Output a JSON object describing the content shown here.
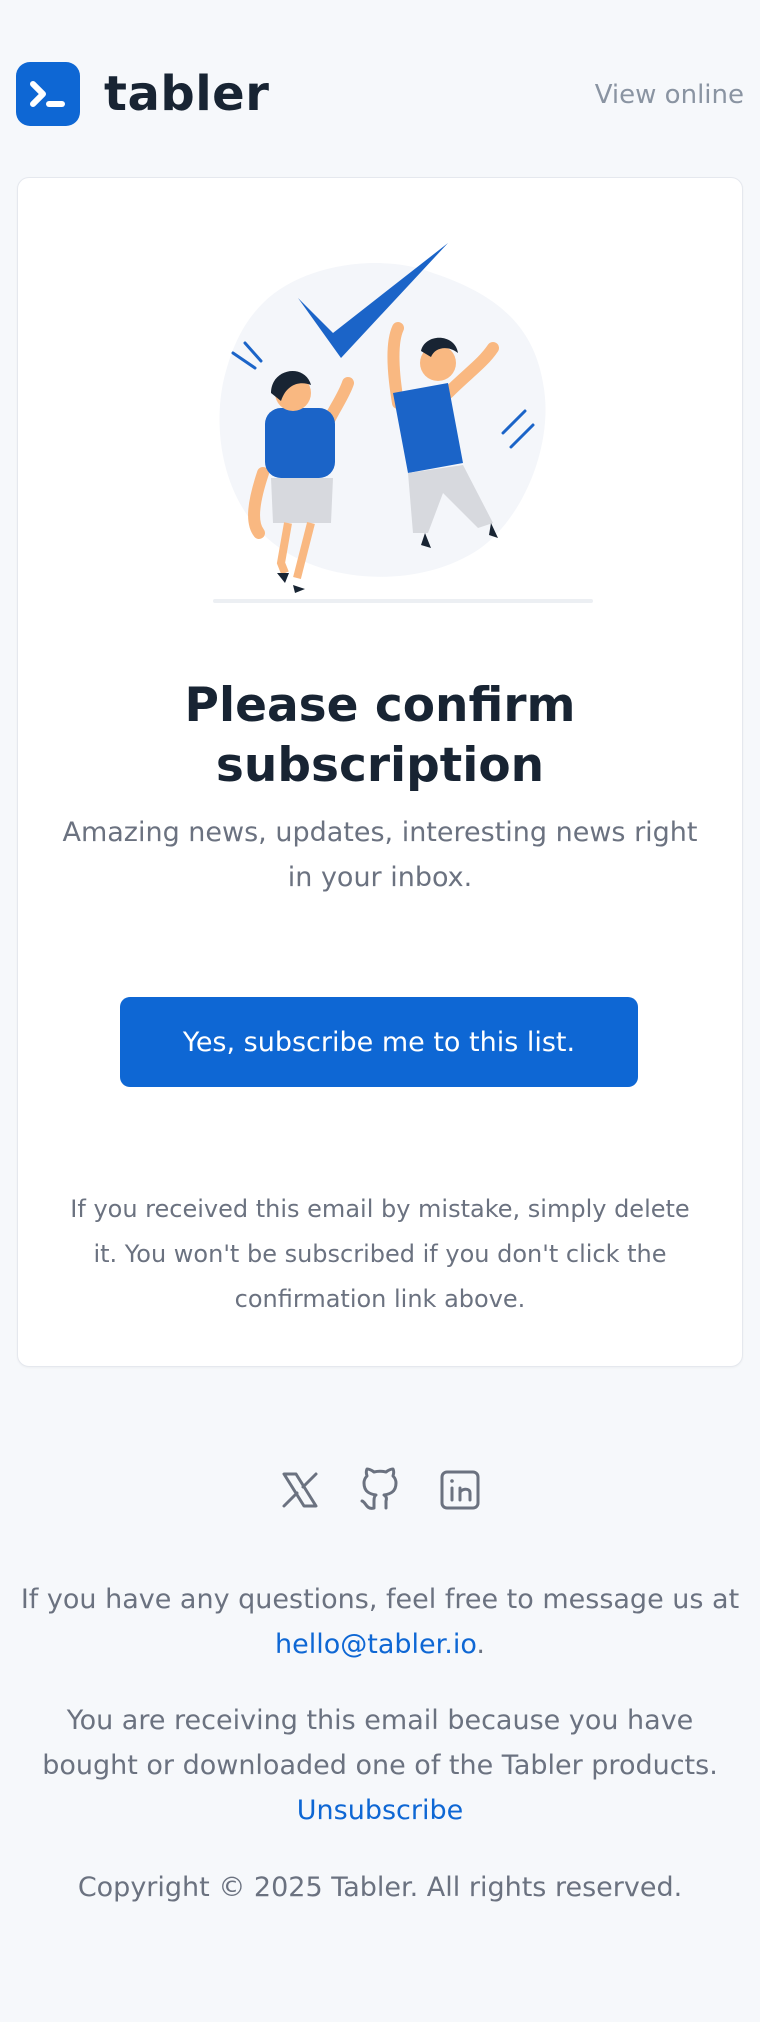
{
  "header": {
    "brand_name": "tabler",
    "view_online_label": "View online"
  },
  "card": {
    "title_line1": "Please confirm",
    "title_line2": "subscription",
    "subtitle": "Amazing news, updates, interesting news right in your inbox.",
    "cta_label": "Yes, subscribe me to this list.",
    "disclaimer": "If you received this email by mistake, simply delete it. You won't be subscribed if you don't click the confirmation link above."
  },
  "socials": [
    {
      "name": "x-icon"
    },
    {
      "name": "github-icon"
    },
    {
      "name": "linkedin-icon"
    }
  ],
  "footer": {
    "questions_text": "If you have any questions, feel free to message us at",
    "email": "hello@tabler.io",
    "email_suffix": ".",
    "receiving_text": "You are receiving this email because you have bought or downloaded one of the Tabler products.",
    "unsubscribe_label": "Unsubscribe",
    "copyright": "Copyright © 2025 Tabler. All rights reserved."
  },
  "colors": {
    "primary": "#0e67d4",
    "background": "#f6f8fb",
    "text_dark": "#182433",
    "text_muted": "#6b7280"
  }
}
